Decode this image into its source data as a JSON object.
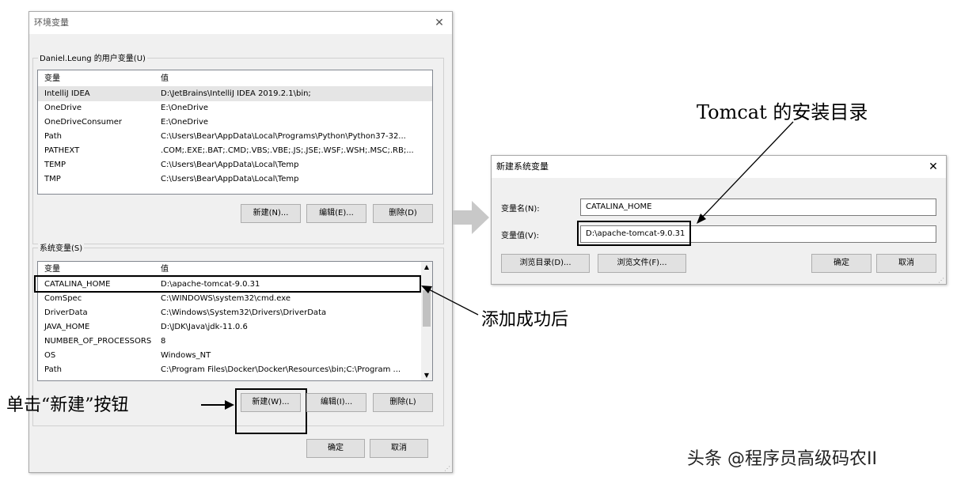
{
  "env_window": {
    "title": "环境变量",
    "user_group_title": "Daniel.Leung 的用户变量(U)",
    "user_columns": [
      "变量",
      "值"
    ],
    "user_rows": [
      [
        "IntelliJ IDEA",
        "D:\\JetBrains\\IntelliJ IDEA 2019.2.1\\bin;"
      ],
      [
        "OneDrive",
        "E:\\OneDrive"
      ],
      [
        "OneDriveConsumer",
        "E:\\OneDrive"
      ],
      [
        "Path",
        "C:\\Users\\Bear\\AppData\\Local\\Programs\\Python\\Python37-32..."
      ],
      [
        "PATHEXT",
        ".COM;.EXE;.BAT;.CMD;.VBS;.VBE;.JS;.JSE;.WSF;.WSH;.MSC;.RB;..."
      ],
      [
        "TEMP",
        "C:\\Users\\Bear\\AppData\\Local\\Temp"
      ],
      [
        "TMP",
        "C:\\Users\\Bear\\AppData\\Local\\Temp"
      ]
    ],
    "user_buttons": {
      "new": "新建(N)...",
      "edit": "编辑(E)...",
      "delete": "删除(D)"
    },
    "system_group_title": "系统变量(S)",
    "system_columns": [
      "变量",
      "值"
    ],
    "system_rows": [
      [
        "CATALINA_HOME",
        "D:\\apache-tomcat-9.0.31"
      ],
      [
        "ComSpec",
        "C:\\WINDOWS\\system32\\cmd.exe"
      ],
      [
        "DriverData",
        "C:\\Windows\\System32\\Drivers\\DriverData"
      ],
      [
        "JAVA_HOME",
        "D:\\JDK\\Java\\jdk-11.0.6"
      ],
      [
        "NUMBER_OF_PROCESSORS",
        "8"
      ],
      [
        "OS",
        "Windows_NT"
      ],
      [
        "Path",
        "C:\\Program Files\\Docker\\Docker\\Resources\\bin;C:\\Program ..."
      ]
    ],
    "system_buttons": {
      "new": "新建(W)...",
      "edit": "编辑(I)...",
      "delete": "删除(L)"
    },
    "ok": "确定",
    "cancel": "取消"
  },
  "new_var_dialog": {
    "title": "新建系统变量",
    "name_label": "变量名(N):",
    "name_value": "CATALINA_HOME",
    "value_label": "变量值(V):",
    "value_value": "D:\\apache-tomcat-9.0.31",
    "browse_dir": "浏览目录(D)...",
    "browse_file": "浏览文件(F)...",
    "ok": "确定",
    "cancel": "取消"
  },
  "annotations": {
    "tomcat_dir": "Tomcat 的安装目录",
    "added": "添加成功后",
    "click_new": "单击“新建”按钮"
  },
  "watermark": "头条 @程序员高级码农II"
}
